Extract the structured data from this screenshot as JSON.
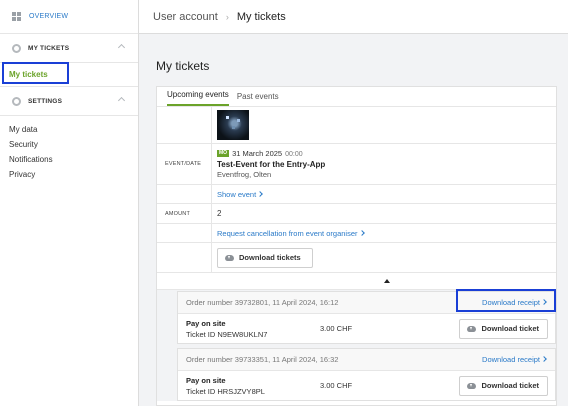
{
  "sidebar": {
    "overview_label": "OVERVIEW",
    "my_tickets_section": "MY TICKETS",
    "my_tickets_item": "My tickets",
    "settings_section": "SETTINGS",
    "settings_items": [
      "My data",
      "Security",
      "Notifications",
      "Privacy"
    ]
  },
  "header": {
    "breadcrumb_parent": "User account",
    "breadcrumb_current": "My tickets"
  },
  "main": {
    "title": "My tickets",
    "tabs": [
      "Upcoming events",
      "Past events"
    ],
    "event": {
      "label_event_date": "EVENT/DATE",
      "badge": "MO",
      "date": "31 March 2025",
      "time": "00:00",
      "name": "Test-Event for the Entry-App",
      "location": "Eventfrog, Olten",
      "show_event_link": "Show event",
      "label_amount": "AMOUNT",
      "amount": "2",
      "cancel_link": "Request cancellation from event organiser",
      "download_tickets": "Download tickets"
    },
    "orders": [
      {
        "header": "Order number 39732801, 11 April 2024, 16:12",
        "receipt_link": "Download receipt",
        "title": "Pay on site",
        "ticket_id": "Ticket ID N9EW8UKLN7",
        "price": "3.00 CHF",
        "button": "Download ticket"
      },
      {
        "header": "Order number 39733351, 11 April 2024, 16:32",
        "receipt_link": "Download receipt",
        "title": "Pay on site",
        "ticket_id": "Ticket ID HRSJZVY8PL",
        "price": "3.00 CHF",
        "button": "Download ticket"
      }
    ]
  },
  "colors": {
    "accent_green": "#6ba32a",
    "link_blue": "#2a7ac8",
    "highlight_box": "#1a3fd6"
  },
  "icons": {
    "overview": "grid-icon",
    "my_tickets": "gear-icon",
    "settings": "gear-icon",
    "download": "cloud-download-icon"
  }
}
